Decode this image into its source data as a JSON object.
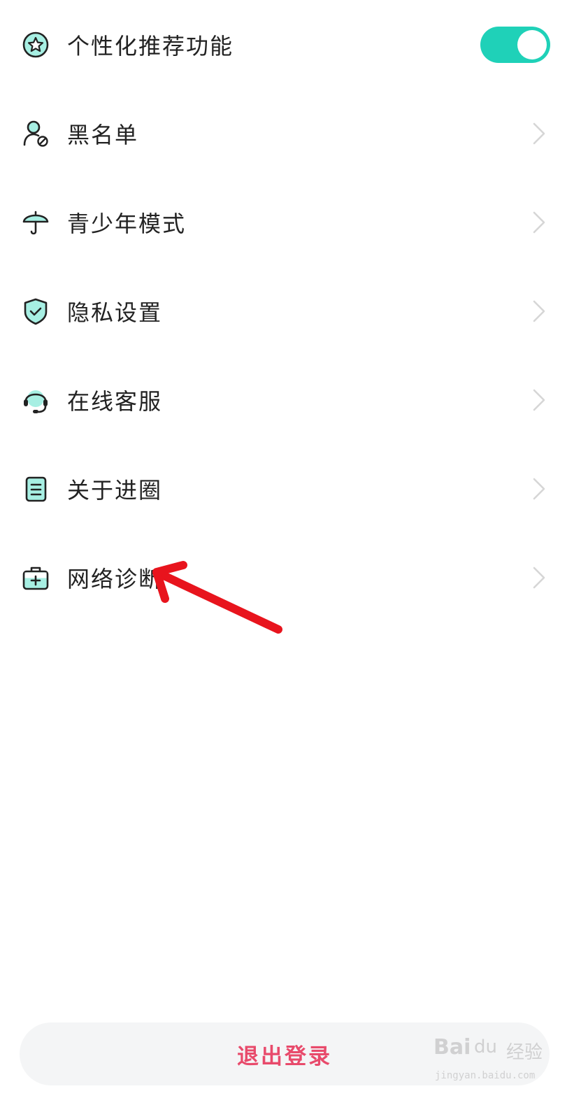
{
  "settings": {
    "items": [
      {
        "label": "个性化推荐功能",
        "icon": "star-circle-icon",
        "control": "toggle",
        "enabled": true
      },
      {
        "label": "黑名单",
        "icon": "user-block-icon",
        "control": "chevron"
      },
      {
        "label": "青少年模式",
        "icon": "umbrella-icon",
        "control": "chevron"
      },
      {
        "label": "隐私设置",
        "icon": "shield-check-icon",
        "control": "chevron"
      },
      {
        "label": "在线客服",
        "icon": "headset-icon",
        "control": "chevron"
      },
      {
        "label": "关于进圈",
        "icon": "document-icon",
        "control": "chevron"
      },
      {
        "label": "网络诊断",
        "icon": "medkit-icon",
        "control": "chevron"
      }
    ]
  },
  "logout": {
    "label": "退出登录"
  },
  "watermark": {
    "brand": "Bai",
    "paw": "du",
    "sub": "经验",
    "url": "jingyan.baidu.com"
  },
  "colors": {
    "accent": "#1fd1b8",
    "icon_fill": "#a7efe3",
    "logout_text": "#e84a6b",
    "annotation_arrow": "#e8141d"
  }
}
